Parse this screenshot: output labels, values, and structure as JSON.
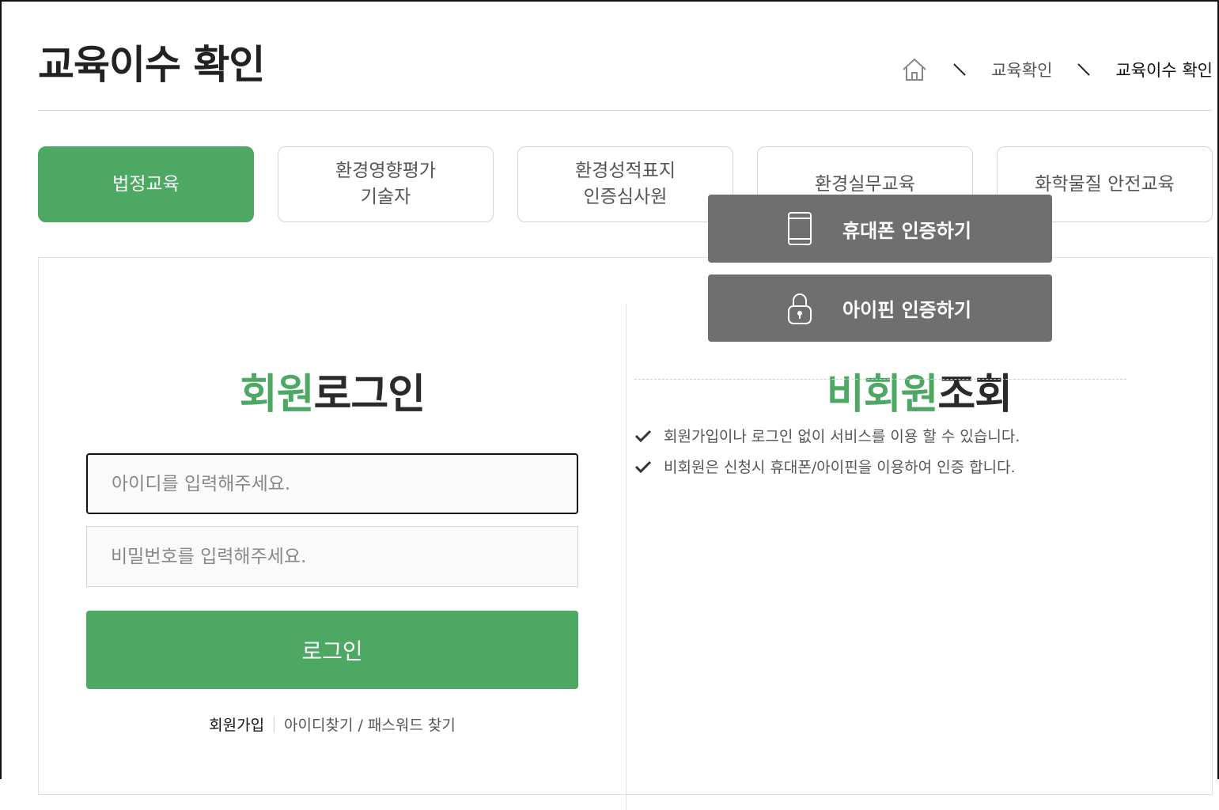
{
  "page": {
    "title": "교육이수 확인"
  },
  "breadcrumb": {
    "home_icon": "home-icon",
    "items": [
      "교육확인",
      "교육이수 확인"
    ]
  },
  "tabs": [
    {
      "label": "법정교육",
      "active": true
    },
    {
      "label": "환경영향평가\n기술자",
      "active": false
    },
    {
      "label": "환경성적표지\n인증심사원",
      "active": false
    },
    {
      "label": "환경실무교육",
      "active": false
    },
    {
      "label": "화학물질 안전교육",
      "active": false
    }
  ],
  "login": {
    "title_accent": "회원",
    "title_rest": "로그인",
    "id_placeholder": "아이디를 입력해주세요.",
    "pw_placeholder": "비밀번호를 입력해주세요.",
    "button": "로그인",
    "join_link": "회원가입",
    "find_link": "아이디찾기 / 패스워드 찾기"
  },
  "guest": {
    "title_accent": "비회원",
    "title_rest": "조회",
    "phone_button": "휴대폰 인증하기",
    "ipin_button": "아이핀 인증하기",
    "notes": [
      "회원가입이나 로그인 없이 서비스를 이용 할 수 있습니다.",
      "비회원은 신청시 휴대폰/아이핀을 이용하여 인증 합니다."
    ]
  },
  "colors": {
    "accent": "#4ca862",
    "button_gray": "#6f6f6f"
  }
}
